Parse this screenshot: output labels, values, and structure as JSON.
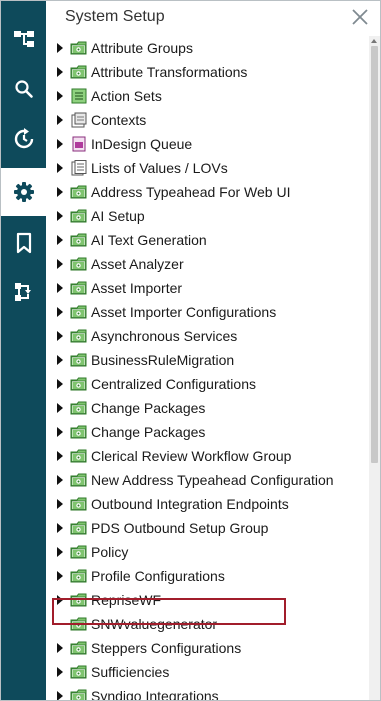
{
  "panel": {
    "title": "System Setup"
  },
  "rail": {
    "items": [
      {
        "name": "tree-hierarchy-icon",
        "active": false
      },
      {
        "name": "search-icon",
        "active": false
      },
      {
        "name": "refresh-history-icon",
        "active": false
      },
      {
        "name": "gear-icon",
        "active": true
      },
      {
        "name": "bookmark-icon",
        "active": false
      },
      {
        "name": "workflow-icon",
        "active": false
      }
    ]
  },
  "tree": {
    "items": [
      {
        "label": "Attribute Groups",
        "icon": "folder-icon",
        "expandable": true
      },
      {
        "label": "Attribute Transformations",
        "icon": "folder-icon",
        "expandable": true
      },
      {
        "label": "Action Sets",
        "icon": "action-set-icon",
        "expandable": true
      },
      {
        "label": "Contexts",
        "icon": "context-icon",
        "expandable": true
      },
      {
        "label": "InDesign Queue",
        "icon": "indesign-queue-icon",
        "expandable": true
      },
      {
        "label": "Lists of Values / LOVs",
        "icon": "list-of-values-icon",
        "expandable": true
      },
      {
        "label": "Address Typeahead For Web UI",
        "icon": "folder-icon",
        "expandable": true
      },
      {
        "label": "AI Setup",
        "icon": "folder-icon",
        "expandable": true
      },
      {
        "label": "AI Text Generation",
        "icon": "folder-icon",
        "expandable": true
      },
      {
        "label": "Asset Analyzer",
        "icon": "folder-icon",
        "expandable": true
      },
      {
        "label": "Asset Importer",
        "icon": "folder-icon",
        "expandable": true
      },
      {
        "label": "Asset Importer Configurations",
        "icon": "folder-icon",
        "expandable": true
      },
      {
        "label": "Asynchronous Services",
        "icon": "folder-icon",
        "expandable": true
      },
      {
        "label": "BusinessRuleMigration",
        "icon": "folder-icon",
        "expandable": true
      },
      {
        "label": "Centralized Configurations",
        "icon": "folder-icon",
        "expandable": true
      },
      {
        "label": "Change Packages",
        "icon": "folder-icon",
        "expandable": true
      },
      {
        "label": "Change Packages",
        "icon": "folder-icon",
        "expandable": true
      },
      {
        "label": "Clerical Review Workflow Group",
        "icon": "folder-icon",
        "expandable": true
      },
      {
        "label": "New Address Typeahead Configuration",
        "icon": "folder-icon",
        "expandable": true
      },
      {
        "label": "Outbound Integration Endpoints",
        "icon": "folder-icon",
        "expandable": true
      },
      {
        "label": "PDS Outbound Setup Group",
        "icon": "folder-icon",
        "expandable": true
      },
      {
        "label": "Policy",
        "icon": "folder-icon",
        "expandable": true
      },
      {
        "label": "Profile Configurations",
        "icon": "folder-icon",
        "expandable": true
      },
      {
        "label": "RepriseWF",
        "icon": "folder-icon",
        "expandable": true
      },
      {
        "label": "SNWvaluegenerator",
        "icon": "folder-icon",
        "expandable": false
      },
      {
        "label": "Steppers Configurations",
        "icon": "folder-icon",
        "expandable": true,
        "highlighted": true
      },
      {
        "label": "Sufficiencies",
        "icon": "folder-icon",
        "expandable": true
      },
      {
        "label": "Syndigo Integrations",
        "icon": "folder-icon",
        "expandable": true
      }
    ]
  },
  "colors": {
    "rail": "#0e4a5b",
    "folder_fill": "#7fc46f",
    "folder_stroke": "#2f7a2a",
    "highlight_border": "#a11d2b"
  }
}
